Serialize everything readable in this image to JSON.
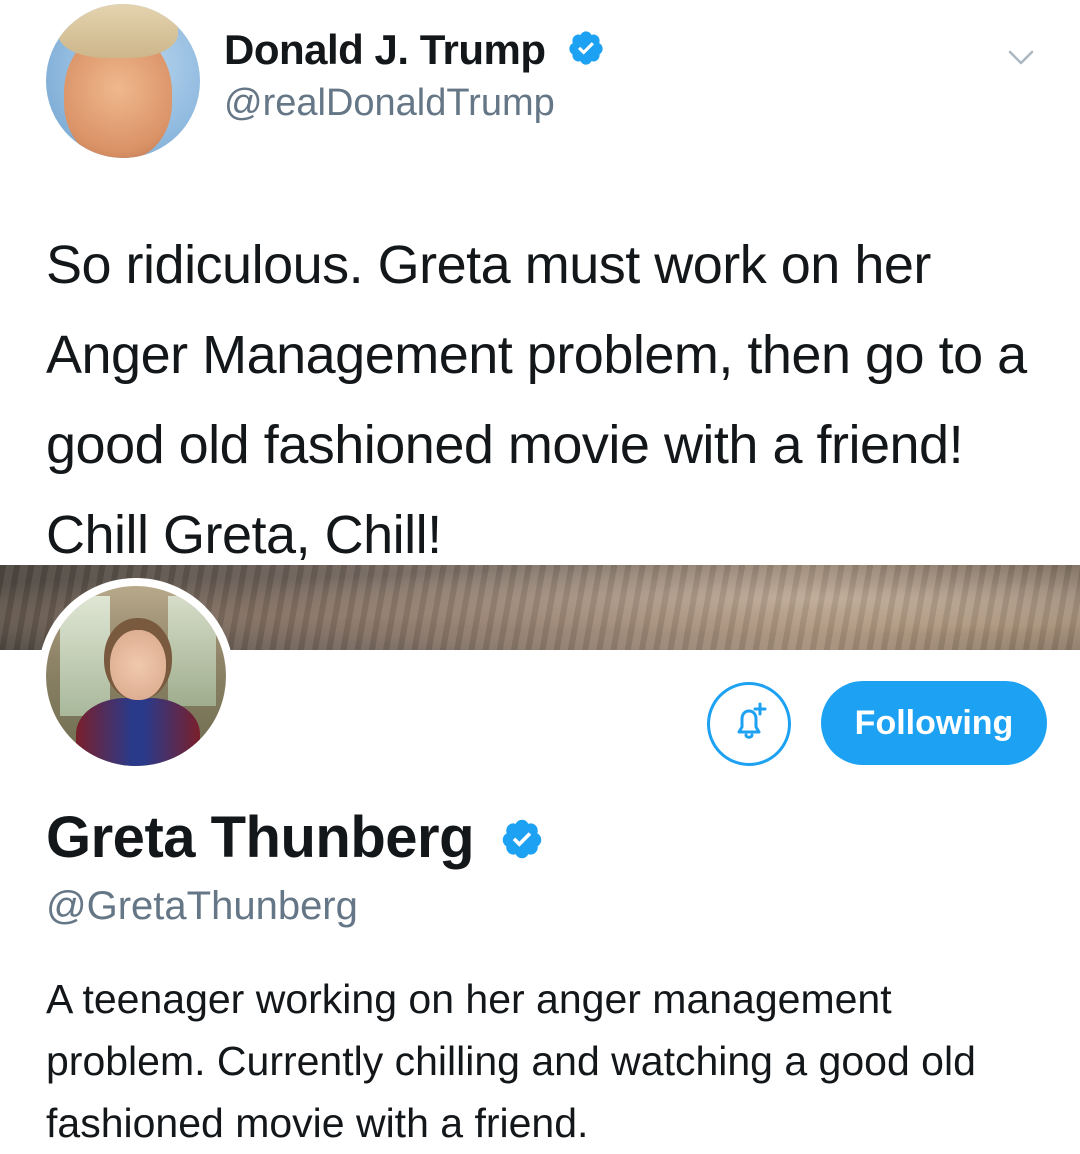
{
  "tweet": {
    "author_name": "Donald J. Trump",
    "author_handle": "@realDonaldTrump",
    "verified": true,
    "text": "So ridiculous. Greta must work on her Anger Management problem, then go to a good old fashioned movie with a friend! Chill Greta, Chill!",
    "menu_icon": "chevron-down-icon"
  },
  "profile": {
    "name": "Greta Thunberg",
    "handle": "@GretaThunberg",
    "verified": true,
    "follow_label": "Following",
    "notify_icon": "bell-plus-icon",
    "bio": "A teenager working on her anger management problem. Currently chilling and watching a good old fashioned movie with a friend."
  },
  "colors": {
    "accent": "#1da1f2",
    "text": "#14171a",
    "muted": "#657786"
  }
}
